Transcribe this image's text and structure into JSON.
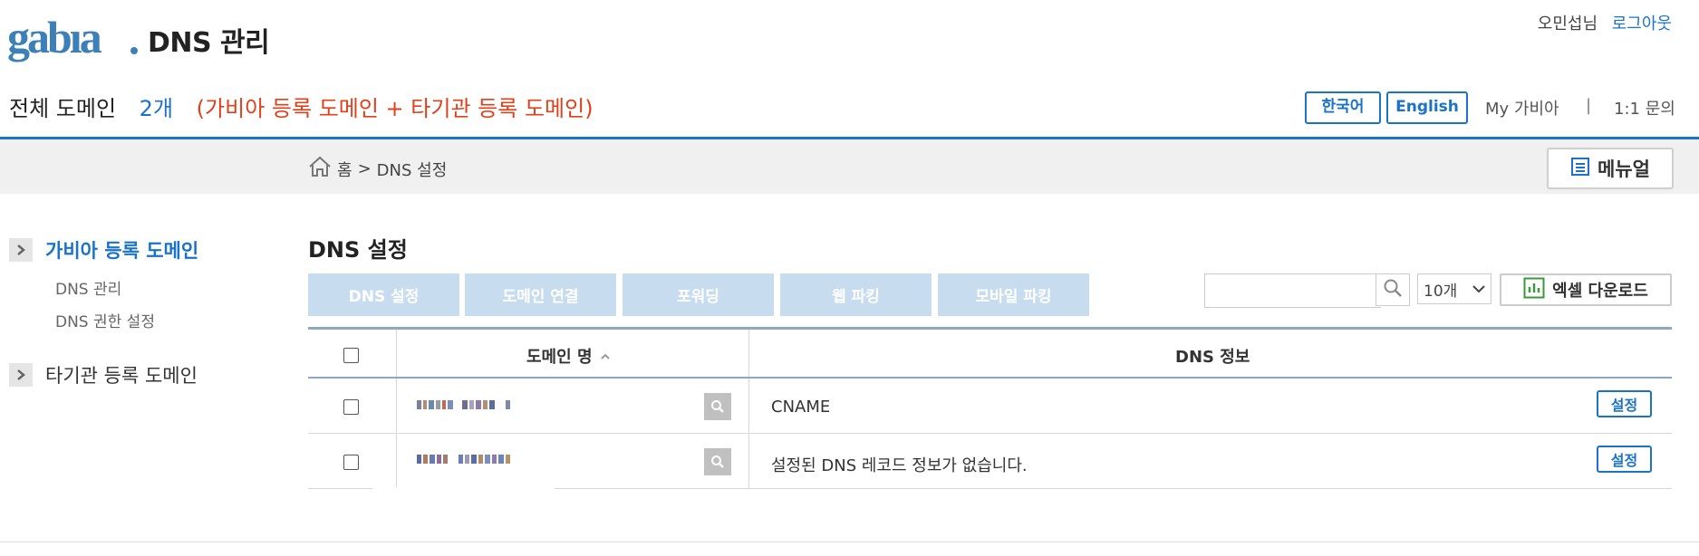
{
  "header": {
    "app_title": "DNS 관리",
    "user_name": "오민섭님",
    "logout": "로그아웃",
    "summary_label": "전체 도메인",
    "summary_count": "2개",
    "summary_note": "(가비아 등록 도메인 + 타기관 등록 도메인)",
    "lang_korean": "한국어",
    "lang_english": "English",
    "my_gabia": "My 가비아",
    "separator": "|",
    "inquiry": "1:1 문의"
  },
  "breadcrumb": {
    "home": "홈",
    "sep": ">",
    "current": "DNS 설정"
  },
  "manual_label": "메뉴얼",
  "sidebar": {
    "group1": "가비아 등록 도메인",
    "group1_items": [
      "DNS 관리",
      "DNS 권한 설정"
    ],
    "group2": "타기관 등록 도메인"
  },
  "main": {
    "title": "DNS 설정",
    "tabs": [
      "DNS 설정",
      "도메인 연결",
      "포워딩",
      "웹 파킹",
      "모바일 파킹"
    ],
    "per_page": "10개",
    "excel": "엑셀 다운로드"
  },
  "table": {
    "col_domain": "도메인 명",
    "col_dns": "DNS 정보",
    "rows": [
      {
        "dns_info": "CNAME",
        "action": "설정"
      },
      {
        "dns_info": "설정된 DNS 레코드 정보가 없습니다.",
        "action": "설정"
      }
    ]
  },
  "colors": {
    "accent": "#1a73c8",
    "note_red": "#e0401a",
    "tab_bg": "#c7ddef",
    "rule": "#8da7c4"
  }
}
